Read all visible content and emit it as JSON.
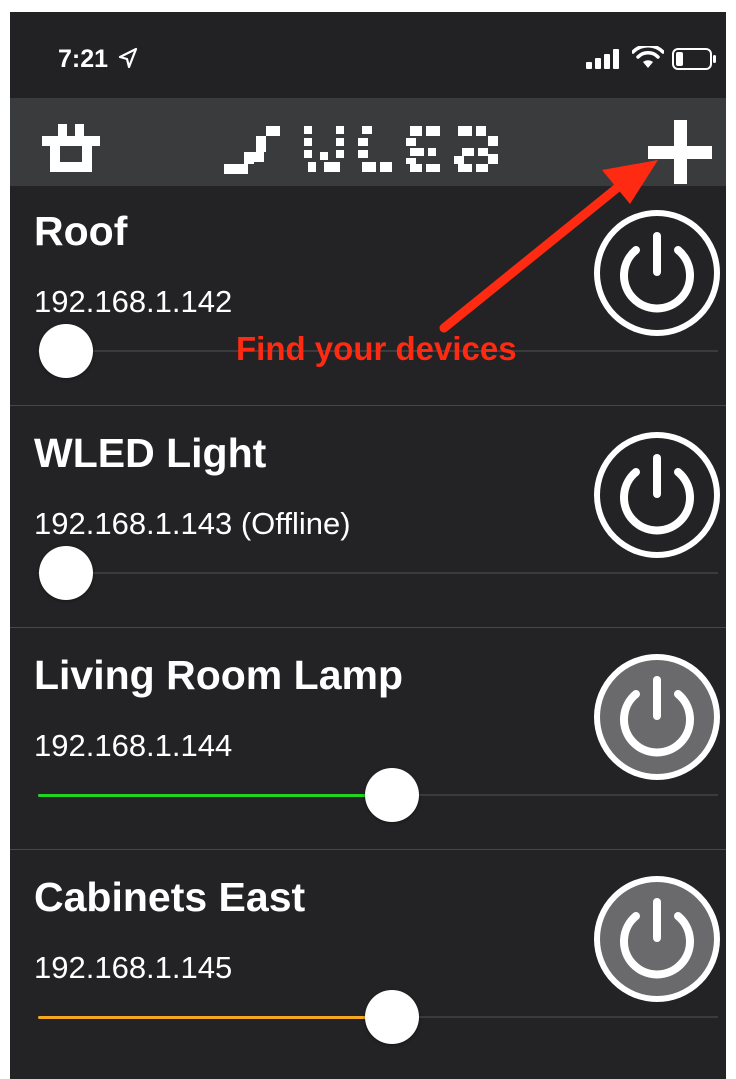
{
  "status_bar": {
    "time": "7:21",
    "icons": [
      "location-arrow-icon",
      "cellular-signal-icon",
      "wifi-icon",
      "battery-icon"
    ]
  },
  "header": {
    "left_icon": "plug-icon",
    "logo_text": "WLED",
    "right_icon": "plus-icon"
  },
  "annotation": {
    "text": "Find your devices",
    "color": "#ff2a12"
  },
  "devices": [
    {
      "name": "Roof",
      "ip": "192.168.1.142",
      "brightness": 0,
      "on": false,
      "color": "#ffffff"
    },
    {
      "name": "WLED Light",
      "ip": "192.168.1.143 (Offline)",
      "brightness": 0,
      "on": false,
      "color": "#ffffff"
    },
    {
      "name": "Living Room Lamp",
      "ip": "192.168.1.144",
      "brightness": 0.5,
      "on": true,
      "color": "#22d321"
    },
    {
      "name": "Cabinets East",
      "ip": "192.168.1.145",
      "brightness": 0.5,
      "on": true,
      "color": "#f5a623"
    }
  ],
  "colors": {
    "background": "#232325",
    "header": "#3a3b3d",
    "power_on_fill": "#6a6a6c"
  }
}
